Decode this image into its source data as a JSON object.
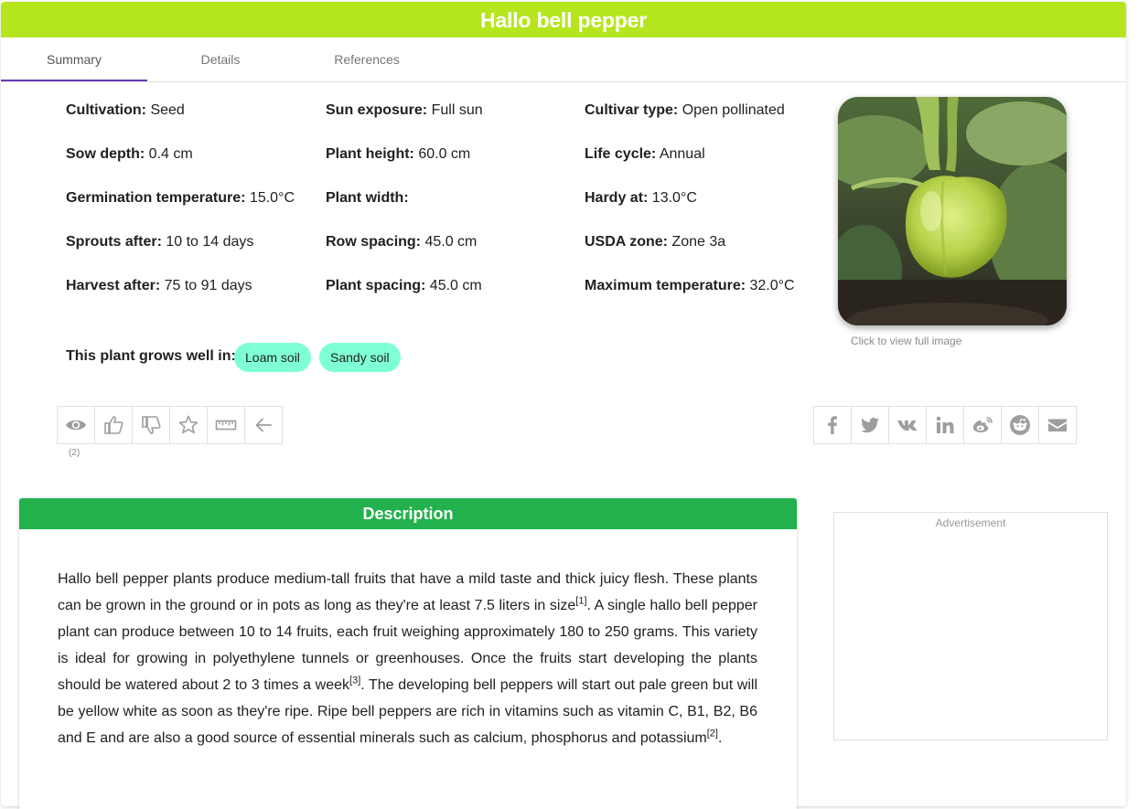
{
  "title": "Hallo bell pepper",
  "tabs": [
    "Summary",
    "Details",
    "References"
  ],
  "facts": [
    {
      "label": "Cultivation:",
      "value": " Seed"
    },
    {
      "label": "Sun exposure:",
      "value": " Full sun"
    },
    {
      "label": "Cultivar type:",
      "value": " Open pollinated"
    },
    {
      "label": "Sow depth:",
      "value": " 0.4 cm"
    },
    {
      "label": "Plant height:",
      "value": " 60.0 cm"
    },
    {
      "label": "Life cycle:",
      "value": " Annual"
    },
    {
      "label": "Germination temperature:",
      "value": " 15.0°C"
    },
    {
      "label": "Plant width:",
      "value": ""
    },
    {
      "label": "Hardy at:",
      "value": " 13.0°C"
    },
    {
      "label": "Sprouts after:",
      "value": " 10 to 14 days"
    },
    {
      "label": "Row spacing:",
      "value": " 45.0 cm"
    },
    {
      "label": "USDA zone:",
      "value": " Zone 3a"
    },
    {
      "label": "Harvest after:",
      "value": " 75 to 91 days"
    },
    {
      "label": "Plant spacing:",
      "value": " 45.0 cm"
    },
    {
      "label": "Maximum temperature:",
      "value": " 32.0°C"
    }
  ],
  "photo_caption": "Click to view full image",
  "grows_label": "This plant grows well in:",
  "soils": [
    "Loam soil",
    "Sandy soil"
  ],
  "actions": {
    "left_icons": [
      "eye-icon",
      "thumbs-up-icon",
      "thumbs-down-icon",
      "star-icon",
      "ruler-icon",
      "arrow-left-icon"
    ],
    "views_count": "(2)",
    "share_icons": [
      "facebook-icon",
      "twitter-icon",
      "vk-icon",
      "linkedin-icon",
      "weibo-icon",
      "reddit-icon",
      "envelope-icon"
    ]
  },
  "description": {
    "header": "Description",
    "parts": [
      {
        "text": "Hallo bell pepper plants produce medium-tall fruits that have a mild taste and thick juicy flesh. These plants can be grown in the ground or in pots as long as they're at least 7.5 liters in size",
        "ref": "[1]"
      },
      {
        "text": ". A single hallo bell pepper plant can produce between 10 to 14 fruits, each fruit weighing approximately 180 to 250 grams. This variety is ideal for growing in polyethylene tunnels or greenhouses. Once the fruits start developing the plants should be watered about 2 to 3 times a week",
        "ref": "[3]"
      },
      {
        "text": ". The developing bell peppers will start out pale green but will be yellow white as soon as they're ripe. Ripe bell peppers are rich in vitamins such as vitamin C, B1, B2, B6 and E and are also a good source of essential minerals such as calcium, phosphorus and potassium",
        "ref": "[2]"
      },
      {
        "text": ".",
        "ref": ""
      }
    ]
  },
  "advertisement_label": "Advertisement",
  "colors": {
    "title_bar": "#b5e61d",
    "description_header": "#22b14c",
    "chip": "#7fffd4",
    "active_tab_underline": "#673ab7"
  }
}
